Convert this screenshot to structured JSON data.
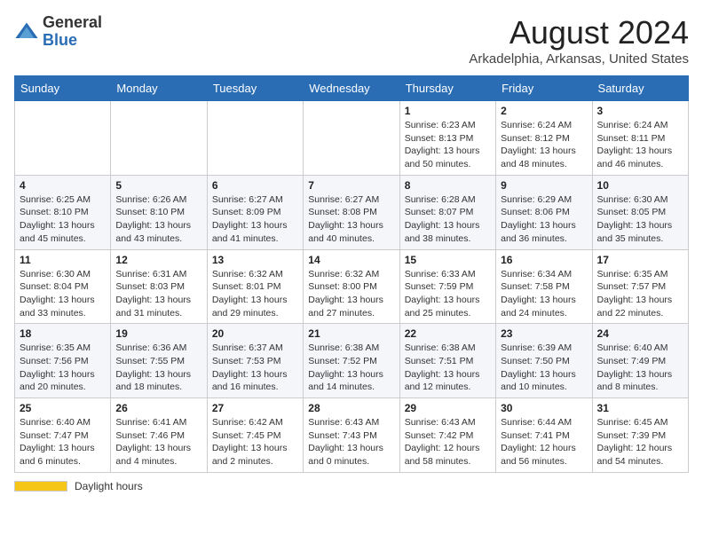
{
  "header": {
    "logo_general": "General",
    "logo_blue": "Blue",
    "main_title": "August 2024",
    "subtitle": "Arkadelphia, Arkansas, United States"
  },
  "calendar": {
    "headers": [
      "Sunday",
      "Monday",
      "Tuesday",
      "Wednesday",
      "Thursday",
      "Friday",
      "Saturday"
    ],
    "weeks": [
      [
        {
          "day": "",
          "sunrise": "",
          "sunset": "",
          "daylight": ""
        },
        {
          "day": "",
          "sunrise": "",
          "sunset": "",
          "daylight": ""
        },
        {
          "day": "",
          "sunrise": "",
          "sunset": "",
          "daylight": ""
        },
        {
          "day": "",
          "sunrise": "",
          "sunset": "",
          "daylight": ""
        },
        {
          "day": "1",
          "sunrise": "Sunrise: 6:23 AM",
          "sunset": "Sunset: 8:13 PM",
          "daylight": "Daylight: 13 hours and 50 minutes."
        },
        {
          "day": "2",
          "sunrise": "Sunrise: 6:24 AM",
          "sunset": "Sunset: 8:12 PM",
          "daylight": "Daylight: 13 hours and 48 minutes."
        },
        {
          "day": "3",
          "sunrise": "Sunrise: 6:24 AM",
          "sunset": "Sunset: 8:11 PM",
          "daylight": "Daylight: 13 hours and 46 minutes."
        }
      ],
      [
        {
          "day": "4",
          "sunrise": "Sunrise: 6:25 AM",
          "sunset": "Sunset: 8:10 PM",
          "daylight": "Daylight: 13 hours and 45 minutes."
        },
        {
          "day": "5",
          "sunrise": "Sunrise: 6:26 AM",
          "sunset": "Sunset: 8:10 PM",
          "daylight": "Daylight: 13 hours and 43 minutes."
        },
        {
          "day": "6",
          "sunrise": "Sunrise: 6:27 AM",
          "sunset": "Sunset: 8:09 PM",
          "daylight": "Daylight: 13 hours and 41 minutes."
        },
        {
          "day": "7",
          "sunrise": "Sunrise: 6:27 AM",
          "sunset": "Sunset: 8:08 PM",
          "daylight": "Daylight: 13 hours and 40 minutes."
        },
        {
          "day": "8",
          "sunrise": "Sunrise: 6:28 AM",
          "sunset": "Sunset: 8:07 PM",
          "daylight": "Daylight: 13 hours and 38 minutes."
        },
        {
          "day": "9",
          "sunrise": "Sunrise: 6:29 AM",
          "sunset": "Sunset: 8:06 PM",
          "daylight": "Daylight: 13 hours and 36 minutes."
        },
        {
          "day": "10",
          "sunrise": "Sunrise: 6:30 AM",
          "sunset": "Sunset: 8:05 PM",
          "daylight": "Daylight: 13 hours and 35 minutes."
        }
      ],
      [
        {
          "day": "11",
          "sunrise": "Sunrise: 6:30 AM",
          "sunset": "Sunset: 8:04 PM",
          "daylight": "Daylight: 13 hours and 33 minutes."
        },
        {
          "day": "12",
          "sunrise": "Sunrise: 6:31 AM",
          "sunset": "Sunset: 8:03 PM",
          "daylight": "Daylight: 13 hours and 31 minutes."
        },
        {
          "day": "13",
          "sunrise": "Sunrise: 6:32 AM",
          "sunset": "Sunset: 8:01 PM",
          "daylight": "Daylight: 13 hours and 29 minutes."
        },
        {
          "day": "14",
          "sunrise": "Sunrise: 6:32 AM",
          "sunset": "Sunset: 8:00 PM",
          "daylight": "Daylight: 13 hours and 27 minutes."
        },
        {
          "day": "15",
          "sunrise": "Sunrise: 6:33 AM",
          "sunset": "Sunset: 7:59 PM",
          "daylight": "Daylight: 13 hours and 25 minutes."
        },
        {
          "day": "16",
          "sunrise": "Sunrise: 6:34 AM",
          "sunset": "Sunset: 7:58 PM",
          "daylight": "Daylight: 13 hours and 24 minutes."
        },
        {
          "day": "17",
          "sunrise": "Sunrise: 6:35 AM",
          "sunset": "Sunset: 7:57 PM",
          "daylight": "Daylight: 13 hours and 22 minutes."
        }
      ],
      [
        {
          "day": "18",
          "sunrise": "Sunrise: 6:35 AM",
          "sunset": "Sunset: 7:56 PM",
          "daylight": "Daylight: 13 hours and 20 minutes."
        },
        {
          "day": "19",
          "sunrise": "Sunrise: 6:36 AM",
          "sunset": "Sunset: 7:55 PM",
          "daylight": "Daylight: 13 hours and 18 minutes."
        },
        {
          "day": "20",
          "sunrise": "Sunrise: 6:37 AM",
          "sunset": "Sunset: 7:53 PM",
          "daylight": "Daylight: 13 hours and 16 minutes."
        },
        {
          "day": "21",
          "sunrise": "Sunrise: 6:38 AM",
          "sunset": "Sunset: 7:52 PM",
          "daylight": "Daylight: 13 hours and 14 minutes."
        },
        {
          "day": "22",
          "sunrise": "Sunrise: 6:38 AM",
          "sunset": "Sunset: 7:51 PM",
          "daylight": "Daylight: 13 hours and 12 minutes."
        },
        {
          "day": "23",
          "sunrise": "Sunrise: 6:39 AM",
          "sunset": "Sunset: 7:50 PM",
          "daylight": "Daylight: 13 hours and 10 minutes."
        },
        {
          "day": "24",
          "sunrise": "Sunrise: 6:40 AM",
          "sunset": "Sunset: 7:49 PM",
          "daylight": "Daylight: 13 hours and 8 minutes."
        }
      ],
      [
        {
          "day": "25",
          "sunrise": "Sunrise: 6:40 AM",
          "sunset": "Sunset: 7:47 PM",
          "daylight": "Daylight: 13 hours and 6 minutes."
        },
        {
          "day": "26",
          "sunrise": "Sunrise: 6:41 AM",
          "sunset": "Sunset: 7:46 PM",
          "daylight": "Daylight: 13 hours and 4 minutes."
        },
        {
          "day": "27",
          "sunrise": "Sunrise: 6:42 AM",
          "sunset": "Sunset: 7:45 PM",
          "daylight": "Daylight: 13 hours and 2 minutes."
        },
        {
          "day": "28",
          "sunrise": "Sunrise: 6:43 AM",
          "sunset": "Sunset: 7:43 PM",
          "daylight": "Daylight: 13 hours and 0 minutes."
        },
        {
          "day": "29",
          "sunrise": "Sunrise: 6:43 AM",
          "sunset": "Sunset: 7:42 PM",
          "daylight": "Daylight: 12 hours and 58 minutes."
        },
        {
          "day": "30",
          "sunrise": "Sunrise: 6:44 AM",
          "sunset": "Sunset: 7:41 PM",
          "daylight": "Daylight: 12 hours and 56 minutes."
        },
        {
          "day": "31",
          "sunrise": "Sunrise: 6:45 AM",
          "sunset": "Sunset: 7:39 PM",
          "daylight": "Daylight: 12 hours and 54 minutes."
        }
      ]
    ]
  },
  "footer": {
    "daylight_label": "Daylight hours"
  }
}
